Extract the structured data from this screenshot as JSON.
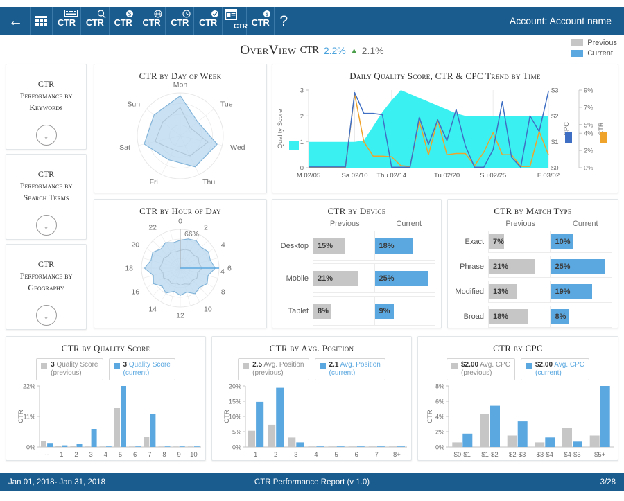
{
  "topbar": {
    "back_icon": "arrow-left-icon",
    "account_label": "Account: Account name",
    "buttons": [
      {
        "name": "dashboard-grid",
        "label": "",
        "icon": "grid-icon"
      },
      {
        "name": "ctr-keywords",
        "label": "CTR",
        "icon": "keyboard-icon"
      },
      {
        "name": "ctr-search",
        "label": "CTR",
        "icon": "search-icon"
      },
      {
        "name": "ctr-cost",
        "label": "CTR",
        "icon": "dollar-icon"
      },
      {
        "name": "ctr-geo",
        "label": "CTR",
        "icon": "globe-icon"
      },
      {
        "name": "ctr-time",
        "label": "CTR",
        "icon": "clock-icon"
      },
      {
        "name": "ctr-quality",
        "label": "CTR",
        "icon": "check-circle-icon"
      },
      {
        "name": "ctr-page",
        "label": "CTR",
        "icon": "document-icon"
      },
      {
        "name": "ctr-budget",
        "label": "CTR",
        "icon": "dollar-badge-icon"
      },
      {
        "name": "help",
        "label": "?",
        "icon": "question-icon"
      }
    ]
  },
  "page_title": {
    "title": "OverView",
    "metric": "CTR",
    "current_value": "2.2%",
    "trend": "▲",
    "previous_value": "2.1%"
  },
  "legend": {
    "previous_label": "Previous",
    "current_label": "Current",
    "previous_color": "#c6c6c6",
    "current_color": "#5ba8e0"
  },
  "sidebar": {
    "cards": [
      {
        "line1": "CTR",
        "line2": "Performance by",
        "line3": "Keywords",
        "action_icon": "down-arrow-circle-icon"
      },
      {
        "line1": "CTR",
        "line2": "Performance by",
        "line3": "Search Terms",
        "action_icon": "down-arrow-circle-icon"
      },
      {
        "line1": "CTR",
        "line2": "Performance by",
        "line3": "Geography",
        "action_icon": "down-arrow-circle-icon"
      }
    ]
  },
  "chart_data": [
    {
      "id": "ctr-by-day-of-week",
      "type": "radar",
      "title": "CTR by Day of Week",
      "categories": [
        "Mon",
        "Tue",
        "Wed",
        "Thu",
        "Fri",
        "Sat",
        "Sun"
      ],
      "series": [
        {
          "name": "Current",
          "values": [
            0.93,
            0.52,
            0.88,
            0.8,
            0.62,
            0.86,
            0.78
          ],
          "color": "#7fb2d8"
        },
        {
          "name": "Previous",
          "values": [
            0.66,
            0.3,
            0.66,
            0.52,
            0.36,
            0.6,
            0.52
          ],
          "color": "#9a9a9a"
        }
      ]
    },
    {
      "id": "daily-quality-score-ctr-cpc-trend",
      "type": "line",
      "title": "Daily Quality Score, CTR & CPC Trend by Time",
      "xlabel": "",
      "x_tick_labels": [
        "M 02/05",
        "Sa 02/10",
        "Thu 02/14",
        "Tu 02/20",
        "Su 02/25",
        "F 03/02"
      ],
      "left_axis": {
        "label": "Quality Score",
        "ticks": [
          "0",
          "1",
          "2",
          "3"
        ],
        "range": [
          0,
          3
        ],
        "color": "#3bf0f0"
      },
      "right_axis_1": {
        "label": "CPC",
        "ticks": [
          "$0",
          "$1",
          "$2",
          "$3"
        ],
        "range": [
          0,
          3
        ],
        "color": "#3f6fc4"
      },
      "right_axis_2": {
        "label": "CTR",
        "ticks": [
          "0%",
          "2%",
          "4%",
          "5%",
          "7%",
          "9%"
        ],
        "range": [
          0,
          9
        ],
        "color": "#f0a32a"
      },
      "series": [
        {
          "name": "Quality Score",
          "color": "#3bf0f0",
          "type": "area",
          "values": [
            1,
            1,
            1,
            1,
            1,
            1,
            1.05,
            1.6,
            2.15,
            2.6,
            3.0,
            2.85,
            2.7,
            2.55,
            2.4,
            2.25,
            2.1,
            2.0,
            2.0,
            2.0,
            2.0,
            2.0,
            2.0,
            2.0,
            2.0,
            2.0,
            2.0
          ]
        },
        {
          "name": "CPC",
          "color": "#3f6fc4",
          "type": "line",
          "values": [
            0.03,
            0.03,
            0.03,
            0.03,
            0.03,
            2.9,
            2.1,
            2.1,
            2.05,
            0.02,
            0.02,
            0.02,
            1.95,
            0.9,
            1.85,
            1.05,
            2.25,
            0.85,
            0.02,
            0.02,
            0.7,
            2.55,
            0.4,
            0.02,
            2.0,
            1.4,
            2.95
          ]
        },
        {
          "name": "CTR",
          "color": "#f0a32a",
          "type": "line",
          "values": [
            0.0,
            0.0,
            0.0,
            0.0,
            0.02,
            2.85,
            1.0,
            0.45,
            0.45,
            0.42,
            0.08,
            0.05,
            1.8,
            0.5,
            1.85,
            0.5,
            0.55,
            0.55,
            0.08,
            0.6,
            1.35,
            0.5,
            0.5,
            0.05,
            0.05,
            1.4,
            0.5
          ]
        }
      ]
    },
    {
      "id": "ctr-by-hour-of-day",
      "type": "radar",
      "title": "CTR by Hour of Day",
      "axis_annotation_outer": "66%",
      "axis_annotation_inner": "4",
      "categories": [
        "0",
        "1",
        "2",
        "3",
        "4",
        "5",
        "6",
        "7",
        "8",
        "9",
        "10",
        "11",
        "12",
        "13",
        "14",
        "15",
        "16",
        "17",
        "18",
        "19",
        "20",
        "21",
        "22",
        "23"
      ],
      "tick_labels": [
        "0",
        "2",
        "4",
        "6",
        "8",
        "10",
        "12",
        "14",
        "16",
        "18",
        "20",
        "22"
      ],
      "series": [
        {
          "name": "Current",
          "color": "#7fb2d8",
          "values": [
            0.72,
            0.78,
            0.82,
            0.76,
            0.84,
            0.8,
            0.9,
            0.74,
            0.8,
            0.7,
            0.76,
            0.64,
            0.7,
            0.62,
            0.74,
            0.66,
            0.8,
            0.72,
            0.92,
            0.78,
            0.82,
            0.7,
            0.76,
            0.68
          ]
        },
        {
          "name": "Previous",
          "color": "#9a9a9a",
          "values": [
            0.46,
            0.5,
            0.52,
            0.48,
            0.54,
            0.5,
            0.56,
            0.46,
            0.5,
            0.44,
            0.48,
            0.42,
            0.44,
            0.4,
            0.46,
            0.42,
            0.5,
            0.46,
            0.54,
            0.48,
            0.5,
            0.44,
            0.48,
            0.44
          ]
        }
      ]
    },
    {
      "id": "ctr-by-device",
      "type": "bar",
      "title": "CTR by Device",
      "col_previous": "Previous",
      "col_current": "Current",
      "categories": [
        "Desktop",
        "Mobile",
        "Tablet"
      ],
      "series": [
        {
          "name": "Previous",
          "values": [
            15,
            21,
            8
          ],
          "labels": [
            "15%",
            "21%",
            "8%"
          ]
        },
        {
          "name": "Current",
          "values": [
            18,
            25,
            9
          ],
          "labels": [
            "18%",
            "25%",
            "9%"
          ]
        }
      ],
      "max": 28
    },
    {
      "id": "ctr-by-match-type",
      "type": "bar",
      "title": "CTR by Match Type",
      "col_previous": "Previous",
      "col_current": "Current",
      "categories": [
        "Exact",
        "Phrase",
        "Modified",
        "Broad"
      ],
      "series": [
        {
          "name": "Previous",
          "values": [
            7,
            21,
            13,
            18
          ],
          "labels": [
            "7%",
            "21%",
            "13%",
            "18%"
          ]
        },
        {
          "name": "Current",
          "values": [
            10,
            25,
            19,
            8
          ],
          "labels": [
            "10%",
            "25%",
            "19%",
            "8%"
          ]
        }
      ],
      "max": 28
    },
    {
      "id": "ctr-by-quality-score",
      "type": "bar",
      "title": "CTR by Quality Score",
      "ylabel": "CTR",
      "y_ticks": [
        "0%",
        "11%",
        "22%"
      ],
      "ylim": [
        0,
        22
      ],
      "categories": [
        "--",
        "1",
        "2",
        "3",
        "4",
        "5",
        "6",
        "7",
        "8",
        "9",
        "10"
      ],
      "legend": [
        {
          "value": "3",
          "name": "Quality Score",
          "state": "(previous)",
          "color": "#c6c6c6"
        },
        {
          "value": "3",
          "name": "Quality Score",
          "state": "(current)",
          "color": "#5ba8e0"
        }
      ],
      "series": [
        {
          "name": "previous",
          "values": [
            2.2,
            0.5,
            0.5,
            0.1,
            0.1,
            14.0,
            0.1,
            3.5,
            0.1,
            0.05,
            0.05
          ]
        },
        {
          "name": "current",
          "values": [
            1.2,
            0.6,
            1.0,
            6.5,
            0.2,
            22.0,
            0.2,
            12.0,
            0.2,
            0.15,
            0.15
          ]
        }
      ]
    },
    {
      "id": "ctr-by-avg-position",
      "type": "bar",
      "title": "CTR by Avg. Position",
      "ylabel": "CTR",
      "y_ticks": [
        "0%",
        "5%",
        "10%",
        "15%",
        "20%"
      ],
      "ylim": [
        0,
        20
      ],
      "categories": [
        "1",
        "2",
        "3",
        "4",
        "5",
        "6",
        "7",
        "8+"
      ],
      "legend": [
        {
          "value": "2.5",
          "name": "Avg. Position",
          "state": "(previous)",
          "color": "#c6c6c6"
        },
        {
          "value": "2.1",
          "name": "Avg. Position",
          "state": "(current)",
          "color": "#5ba8e0"
        }
      ],
      "series": [
        {
          "name": "previous",
          "values": [
            5.3,
            7.3,
            3.1,
            0.1,
            0.1,
            0.1,
            0.1,
            0.1
          ]
        },
        {
          "name": "current",
          "values": [
            14.8,
            19.4,
            1.5,
            0.15,
            0.15,
            0.15,
            0.15,
            0.15
          ]
        }
      ]
    },
    {
      "id": "ctr-by-cpc",
      "type": "bar",
      "title": "CTR by CPC",
      "ylabel": "CTR",
      "y_ticks": [
        "0%",
        "2%",
        "4%",
        "6%",
        "8%"
      ],
      "ylim": [
        0,
        8
      ],
      "categories": [
        "$0-$1",
        "$1-$2",
        "$2-$3",
        "$3-$4",
        "$4-$5",
        "$5+"
      ],
      "legend": [
        {
          "value": "$2.00",
          "name": "Avg. CPC",
          "state": "(previous)",
          "color": "#c6c6c6"
        },
        {
          "value": "$2.00",
          "name": "Avg. CPC",
          "state": "(current)",
          "color": "#5ba8e0"
        }
      ],
      "series": [
        {
          "name": "previous",
          "values": [
            0.6,
            4.3,
            1.5,
            0.6,
            2.5,
            1.5
          ]
        },
        {
          "name": "current",
          "values": [
            1.75,
            5.4,
            3.35,
            1.25,
            0.7,
            8.0
          ]
        }
      ]
    }
  ],
  "footer": {
    "date_range": "Jan 01, 2018- Jan 31, 2018",
    "report_name": "CTR Performance Report (v 1.0)",
    "page": "3/28"
  }
}
